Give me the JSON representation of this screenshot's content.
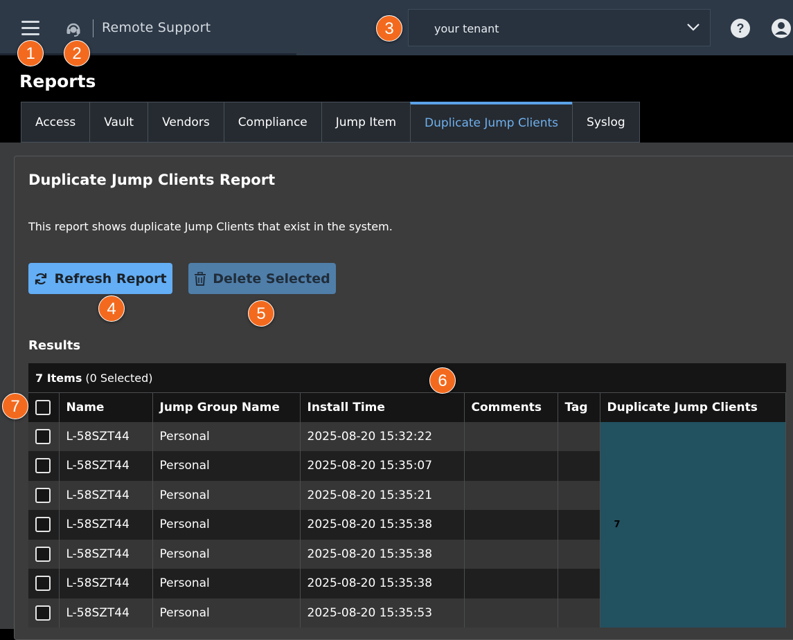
{
  "header": {
    "app_title": "Remote Support",
    "tenant": {
      "value": "your tenant"
    },
    "icons": {
      "menu": "hamburger-menu-icon",
      "app": "headset-icon",
      "help": "help-icon",
      "user": "user-account-icon",
      "tenant_chevron": "chevron-down-icon"
    }
  },
  "page": {
    "title": "Reports"
  },
  "tabs": [
    {
      "label": "Access",
      "active": false
    },
    {
      "label": "Vault",
      "active": false
    },
    {
      "label": "Vendors",
      "active": false
    },
    {
      "label": "Compliance",
      "active": false
    },
    {
      "label": "Jump Item",
      "active": false
    },
    {
      "label": "Duplicate Jump Clients",
      "active": true
    },
    {
      "label": "Syslog",
      "active": false
    }
  ],
  "report": {
    "title": "Duplicate Jump Clients Report",
    "description": "This report shows duplicate Jump Clients that exist in the system.",
    "refresh_label": "Refresh Report",
    "delete_label": "Delete Selected",
    "results_label": "Results"
  },
  "table": {
    "items_count": "7 Items",
    "selected_text": "(0 Selected)",
    "columns": [
      "Name",
      "Jump Group Name",
      "Install Time",
      "Comments",
      "Tag",
      "Duplicate Jump Clients"
    ],
    "duplicate_count": "7",
    "rows": [
      {
        "name": "L-58SZT44",
        "group": "Personal",
        "install_time": "2025-08-20 15:32:22",
        "comments": "",
        "tag": ""
      },
      {
        "name": "L-58SZT44",
        "group": "Personal",
        "install_time": "2025-08-20 15:35:07",
        "comments": "",
        "tag": ""
      },
      {
        "name": "L-58SZT44",
        "group": "Personal",
        "install_time": "2025-08-20 15:35:21",
        "comments": "",
        "tag": ""
      },
      {
        "name": "L-58SZT44",
        "group": "Personal",
        "install_time": "2025-08-20 15:35:38",
        "comments": "",
        "tag": ""
      },
      {
        "name": "L-58SZT44",
        "group": "Personal",
        "install_time": "2025-08-20 15:35:38",
        "comments": "",
        "tag": ""
      },
      {
        "name": "L-58SZT44",
        "group": "Personal",
        "install_time": "2025-08-20 15:35:38",
        "comments": "",
        "tag": ""
      },
      {
        "name": "L-58SZT44",
        "group": "Personal",
        "install_time": "2025-08-20 15:35:53",
        "comments": "",
        "tag": ""
      }
    ]
  },
  "callouts": [
    "1",
    "2",
    "3",
    "4",
    "5",
    "6",
    "7"
  ],
  "colors": {
    "accent": "#63aef5",
    "callout": "#f36a1e",
    "dup_cell": "#225160"
  }
}
